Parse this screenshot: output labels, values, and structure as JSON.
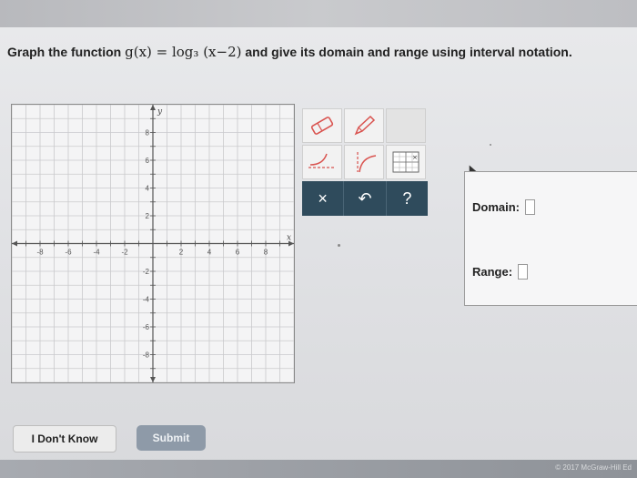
{
  "question": {
    "prefix": "Graph the function ",
    "function_math": "g(x) = log₃ (x−2)",
    "suffix": " and give its domain and range using interval notation."
  },
  "graph": {
    "x_axis_label": "x",
    "y_axis_label": "y",
    "x_ticks": [
      "-8",
      "-6",
      "-4",
      "-2",
      "2",
      "4",
      "6",
      "8"
    ],
    "y_ticks": [
      "8",
      "6",
      "4",
      "2",
      "-2",
      "-4",
      "-6",
      "-8"
    ],
    "x_range": [
      -10,
      10
    ],
    "y_range": [
      -10,
      10
    ],
    "grid": true
  },
  "toolbar": {
    "tools": [
      "eraser-tool",
      "pencil-tool",
      "asymptote-curve-tool",
      "log-curve-tool",
      "vertical-asymptote-tool"
    ],
    "actions": {
      "clear": "×",
      "undo": "↶",
      "help": "?"
    }
  },
  "answers": {
    "domain_label": "Domain:",
    "range_label": "Range:"
  },
  "buttons": {
    "dont_know": "I Don't Know",
    "submit": "Submit"
  },
  "footer": {
    "copyright": "© 2017 McGraw-Hill Ed"
  },
  "colors": {
    "action_bar": "#2f4b5c",
    "tool_red": "#d9534f",
    "submit": "#8e9aa8"
  }
}
